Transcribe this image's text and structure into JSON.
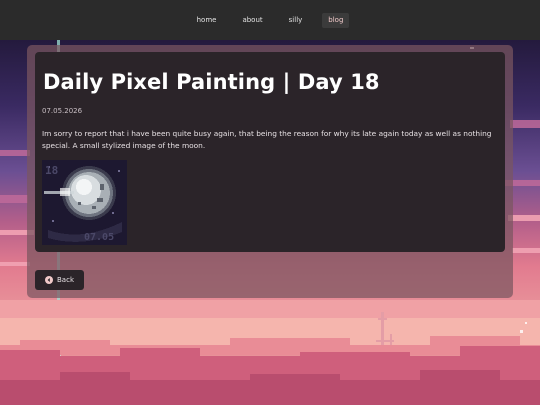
{
  "nav": {
    "items": [
      {
        "label": "home",
        "active": false
      },
      {
        "label": "about",
        "active": false
      },
      {
        "label": "silly",
        "active": false
      },
      {
        "label": "blog",
        "active": true
      }
    ]
  },
  "post": {
    "title": "Daily Pixel Painting | Day 18",
    "date": "07.05.2026",
    "body": "Im sorry to report that i have been quite busy again, that being the reason for why its late again today as well as nothing special. A small stylized image of the moon.",
    "image_caption": "07.05",
    "image_tag": "18"
  },
  "back_button": {
    "label": "Back",
    "icon": "arrow-left-circle-icon"
  },
  "colors": {
    "nav_bg": "#2b2b2b",
    "card_bg": "#2b2429",
    "overlay": "#7a5660",
    "active_nav_text": "#f0c9c9",
    "sky_top": "#2d1e4a",
    "sky_pink": "#e2748c",
    "ground": "#d5667f"
  }
}
